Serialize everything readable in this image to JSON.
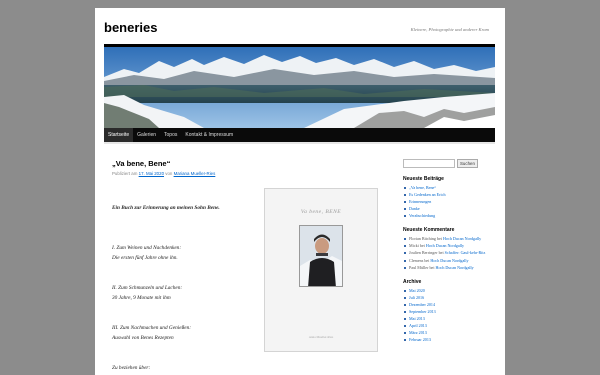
{
  "site": {
    "title": "beneries",
    "description": "Kleinere, Photographie und anderer Kram"
  },
  "nav": {
    "items": [
      "Startseite",
      "Galerien",
      "Topos",
      "Kontakt & Impressum"
    ]
  },
  "post": {
    "title": "„Va bene, Bene“",
    "meta_prefix": "Publiziert am",
    "date": "17. Mai 2020",
    "meta_by": "von",
    "author": "Mariana Mueller-Ries",
    "lines": [
      "Ein Buch zur Erinnerung an meinen Sohn Bene.",
      "I.   Zum Weinen und Nachdenken:",
      "Die ersten fünf Jahre ohne ihn.",
      "II.  Zum Schmunzeln und Lachen:",
      "30 Jahre, 9 Monate mit ihm",
      "III. Zum Nachmachen und Genießen:",
      "Auswahl von Benes Rezepten",
      "Zu beziehen über:"
    ],
    "cover_title": "Va bene, BENE",
    "cover_author": "Anna Mueller-Ries"
  },
  "sidebar": {
    "search_button": "Suchen",
    "recent_posts_title": "Neueste Beiträge",
    "recent_posts": [
      "„Va bene, Bene“",
      "Es Gedenken an Erich",
      "Erinnerungen",
      "Danke",
      "Verabschiedung"
    ],
    "recent_comments_title": "Neueste Kommentare",
    "recent_comments": [
      {
        "who": "Florian Bitching",
        "on": "bei",
        "post": "Hoch Ducan Nordgally"
      },
      {
        "who": "Micki",
        "on": "bei",
        "post": "Hoch Ducan Nordgally"
      },
      {
        "who": "Joulien Berringer",
        "on": "bei",
        "post": "Schaffer: Gaul-kehr-Ritz"
      },
      {
        "who": "Clemens",
        "on": "bei",
        "post": "Hoch Ducan Nordgally"
      },
      {
        "who": "Paul Müller",
        "on": "bei",
        "post": "Hoch Ducan Nordgally"
      }
    ],
    "archive_title": "Archive",
    "archive": [
      "Mai 2020",
      "Juli 2016",
      "Dezember 2014",
      "September 2013",
      "Mai 2013",
      "April 2013",
      "März 2013",
      "Februar 2013"
    ]
  }
}
